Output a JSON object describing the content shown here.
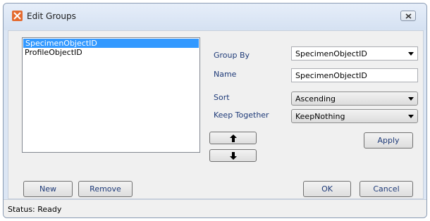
{
  "window": {
    "title": "Edit Groups",
    "app_icon": "app-logo-icon",
    "close_icon": "close-icon"
  },
  "list": {
    "items": [
      "SpecimenObjectID",
      "ProfileObjectID"
    ],
    "selected_index": 0
  },
  "form": {
    "group_by_label": "Group By",
    "group_by_value": "SpecimenObjectID",
    "name_label": "Name",
    "name_value": "SpecimenObjectID",
    "sort_label": "Sort",
    "sort_value": "Ascending",
    "keep_together_label": "Keep Together",
    "keep_together_value": "KeepNothing"
  },
  "buttons": {
    "move_up_icon": "arrow-up-icon",
    "move_down_icon": "arrow-down-icon",
    "apply": "Apply",
    "new": "New",
    "remove": "Remove",
    "ok": "OK",
    "cancel": "Cancel"
  },
  "status": {
    "text": "Status: Ready"
  }
}
